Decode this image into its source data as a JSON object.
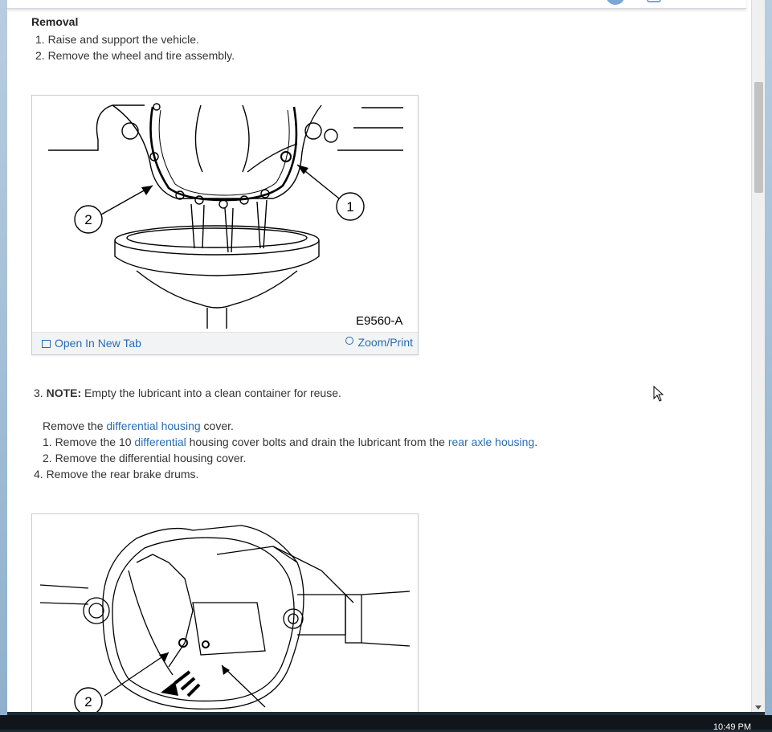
{
  "section": {
    "heading": "Removal"
  },
  "steps": {
    "s1": "1. Raise and support the vehicle.",
    "s2": "2. Remove the wheel and tire assembly.",
    "s3_prefix": "3. ",
    "s3_note_label": "NOTE:",
    "s3_note_text": " Empty the lubricant into a clean container for reuse.",
    "remove_prefix": "Remove the ",
    "remove_link": "differential housing",
    "remove_suffix": " cover.",
    "sub1_prefix": "1. Remove the 10 ",
    "sub1_link": "differential",
    "sub1_mid": " housing cover bolts and drain the lubricant from the ",
    "sub1_link2": "rear axle housing",
    "sub1_end": ".",
    "sub2": "2. Remove the differential housing cover.",
    "s4": "4. Remove the rear brake drums."
  },
  "figure1": {
    "code": "E9560-A",
    "callout_1": "1",
    "callout_2": "2",
    "open_tab_label": "Open In New Tab",
    "zoom_label": "Zoom/Print"
  },
  "figure2": {
    "callout_2": "2"
  },
  "taskbar": {
    "clock": "10:49 PM"
  },
  "icons": {
    "open_tab": "open-in-new-tab-icon",
    "zoom": "magnifier-zoom-icon"
  },
  "colors": {
    "link": "#2b6cb0",
    "toolbar_bg": "#f1f3f5"
  }
}
